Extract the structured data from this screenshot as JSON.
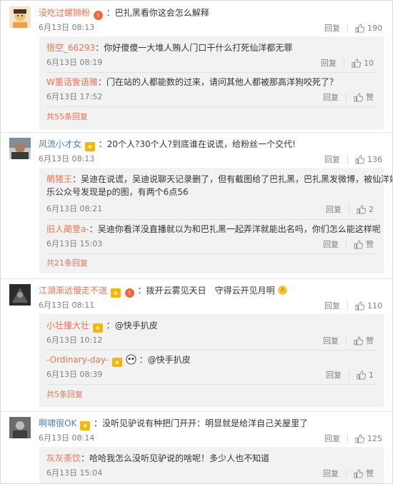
{
  "actions": {
    "reply": "回复",
    "like": "赞"
  },
  "threads": [
    {
      "user": "没吃过螺狮粉",
      "text": "巴扎黑看你这会怎么解释",
      "date": "6月13日 08:13",
      "likes": "190",
      "replies": [
        {
          "user": "悟空_66293",
          "text": "你好傻傻一大堆人贿人门口干什么打死仙洋都无罪",
          "date": "6月13日 08:19",
          "likes": "10"
        },
        {
          "user": "W董话訾语雅",
          "text": "门在站的人都能数的过来，请问其他人都被那高洋狗咬死了？",
          "date": "6月13日 17:52",
          "likes": "赞"
        }
      ],
      "more": "共55条回复"
    },
    {
      "user": "风流小才女",
      "text": "20个人?30个人?到底谁在说谎，给粉丝一个交代!",
      "date": "6月13日 08:13",
      "likes": "136",
      "replies": [
        {
          "user": "萌猪王",
          "text": "吴迪在说谎，吴迪说聊天记录删了，但有截图给了巴扎黑，巴扎黑发微博，被仙洋娱",
          "text2": "乐公众号发现是p的图，有两个6点56",
          "date": "6月13日 08:21",
          "likes": "2"
        },
        {
          "user": "旧人蔺萱a-",
          "text": "吴迪你看洋没直播就以为和巴扎黑一起弄洋就能出名吗，你们怎么能这样呢",
          "date": "6月13日 15:03",
          "likes": "赞"
        }
      ],
      "more": "共21条回复"
    },
    {
      "user": "江湖渐远慢走不送",
      "text": "拨开云雾见天日　守得云开见月明",
      "date": "6月13日 08:11",
      "likes": "110",
      "replies": [
        {
          "user": "小壮撞大壮",
          "text": "@快手扒皮",
          "date": "6月13日 10:12",
          "likes": "赞"
        },
        {
          "user": "-Ordinary-day-",
          "text": "@快手扒皮",
          "date": "6月13日 08:39",
          "likes": "1"
        }
      ],
      "more": "共5条回复"
    },
    {
      "user": "啊啸很OK",
      "text": "没听见驴说有种把门开开：明显就是给洋自己关屋里了",
      "date": "6月13日 08:14",
      "likes": "125",
      "replies": [
        {
          "user": "灰灰荼饮",
          "text": "哈哈我怎么没听见驴说的啥呢！多少人也不知道",
          "date": "6月13日 15:04",
          "likes": "赞"
        }
      ]
    }
  ]
}
